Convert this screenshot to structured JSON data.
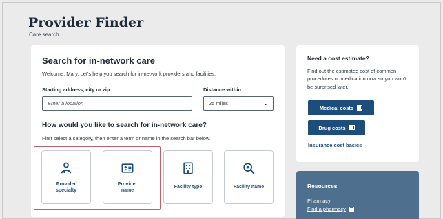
{
  "header": {
    "title": "Provider Finder",
    "breadcrumb": "Care search"
  },
  "search": {
    "heading": "Search for in-network care",
    "welcome": "Welcome, Mary. Let's help you search for in-network providers and facilities.",
    "address_label": "Starting address, city or zip",
    "address_placeholder": "Enter a location",
    "distance_label": "Distance within",
    "distance_value": "25 miles"
  },
  "category": {
    "heading": "How would you like to search for in-network care?",
    "subtext": "First select a category, then enter a term or name in the search bar below.",
    "items": [
      {
        "label_line1": "Provider",
        "label_line2": "specialty",
        "icon": "doctor-icon"
      },
      {
        "label_line1": "Provider",
        "label_line2": "name",
        "icon": "id-card-icon"
      },
      {
        "label_line1": "Facility type",
        "icon": "building-icon"
      },
      {
        "label_line1": "Facility name",
        "icon": "search-icon"
      }
    ]
  },
  "cost": {
    "title": "Need a cost estimate?",
    "description": "Find out the estimated cost of common procedures or medication now so you won't be surprised later.",
    "medical_button": "Medical costs",
    "drug_button": "Drug costs",
    "basics_link": "Insurance cost basics"
  },
  "resources": {
    "title": "Resources",
    "pharmacy_label": "Pharmacy",
    "pharmacy_link": "Find a pharmacy"
  },
  "colors": {
    "primary": "#1c4d7b",
    "highlight": "#b9646a",
    "resources_bg": "#4e6f8d"
  }
}
